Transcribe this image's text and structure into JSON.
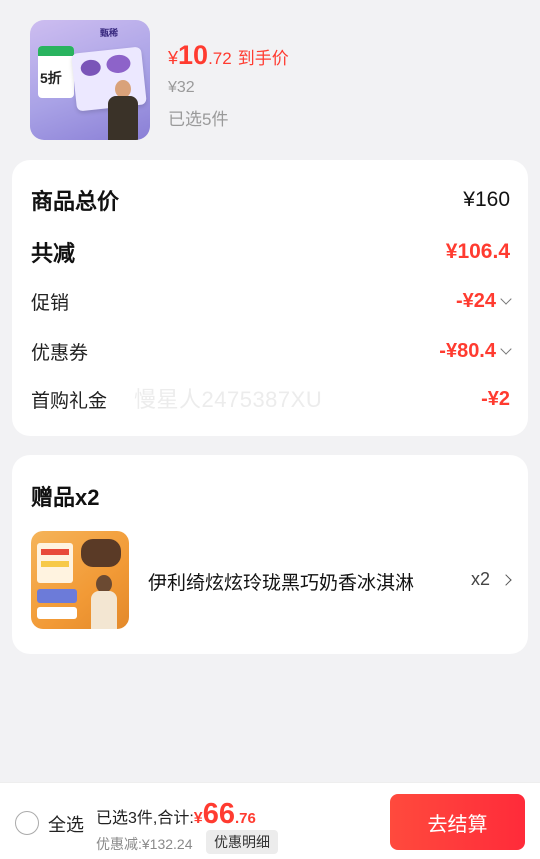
{
  "product": {
    "image_icon": "ice-cream-product-image",
    "thumb_tag_text": "5折",
    "thumb_brand_text": "甄稀",
    "price_currency": "¥",
    "price_int": "10",
    "price_dec": ".72",
    "price_label": "到手价",
    "original_price": "¥32",
    "selected_count": "已选5件"
  },
  "summary": {
    "total_label": "商品总价",
    "total_value": "¥160",
    "reduce_label": "共减",
    "reduce_value": "¥106.4",
    "promo_label": "促销",
    "promo_value": "-¥24",
    "coupon_label": "优惠券",
    "coupon_value": "-¥80.4",
    "first_gift_label": "首购礼金",
    "first_gift_value": "-¥2",
    "watermark": "慢星人2475387XU"
  },
  "gifts": {
    "title": "赠品x2",
    "item_name": "伊利绮炫炫玲珑黑巧奶香冰淇淋",
    "item_qty": "x2",
    "item_icon": "chocolate-icecream-gift-image"
  },
  "bottom": {
    "select_all": "全选",
    "summary_prefix": "已选3件,合计:",
    "total_currency": "¥",
    "total_int": "66",
    "total_dec": ".76",
    "discount_text": "优惠减:¥132.24",
    "detail_button": "优惠明细",
    "checkout_button": "去结算"
  },
  "colors": {
    "accent": "#ff3b30",
    "background": "#f2f2f4",
    "card": "#ffffff"
  }
}
